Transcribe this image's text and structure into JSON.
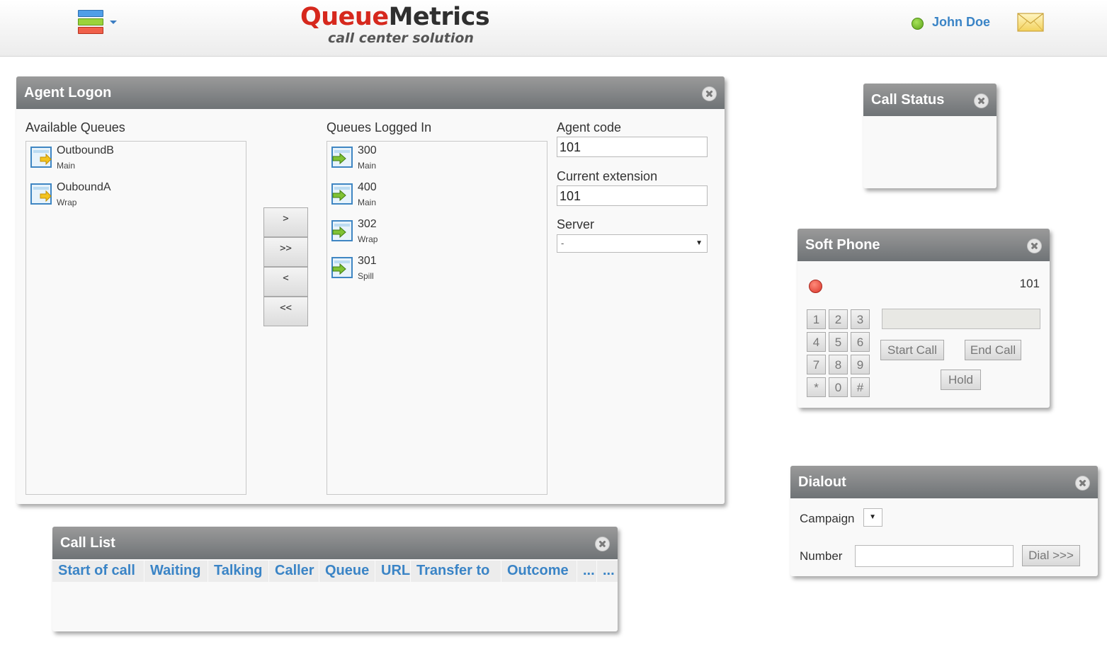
{
  "header": {
    "logo_main_1": "Queue",
    "logo_main_2": "Metrics",
    "logo_sub": "call center solution",
    "user_name": "John Doe"
  },
  "colors": {
    "accent": "#3a84c6",
    "logo_red": "#d6281d",
    "panel_header": "#7b7e81",
    "status_ok": "#7fc234",
    "status_error": "#e4493b"
  },
  "agent_logon": {
    "title": "Agent Logon",
    "available_label": "Available Queues",
    "available": [
      {
        "name": "OutboundB",
        "sub": "Main"
      },
      {
        "name": "OuboundA",
        "sub": "Wrap"
      }
    ],
    "logged_label": "Queues Logged In",
    "logged": [
      {
        "name": "300",
        "sub": "Main"
      },
      {
        "name": "400",
        "sub": "Main"
      },
      {
        "name": "302",
        "sub": "Wrap"
      },
      {
        "name": "301",
        "sub": "Spill"
      }
    ],
    "buttons": [
      ">",
      ">>",
      "<",
      "<<"
    ],
    "agent_code_label": "Agent code",
    "agent_code_value": "101",
    "extension_label": "Current extension",
    "extension_value": "101",
    "server_label": "Server",
    "server_value": "-"
  },
  "call_status": {
    "title": "Call Status"
  },
  "soft_phone": {
    "title": "Soft Phone",
    "extension": "101",
    "keys": [
      "1",
      "2",
      "3",
      "4",
      "5",
      "6",
      "7",
      "8",
      "9",
      "*",
      "0",
      "#"
    ],
    "start_call": "Start Call",
    "end_call": "End Call",
    "hold": "Hold"
  },
  "dialout": {
    "title": "Dialout",
    "campaign_label": "Campaign",
    "number_label": "Number",
    "number_value": "",
    "dial_button": "Dial >>>"
  },
  "call_list": {
    "title": "Call List",
    "columns": [
      "Start of call",
      "Waiting",
      "Talking",
      "Caller",
      "Queue",
      "URL",
      "Transfer to",
      "Outcome",
      "...",
      "..."
    ]
  }
}
